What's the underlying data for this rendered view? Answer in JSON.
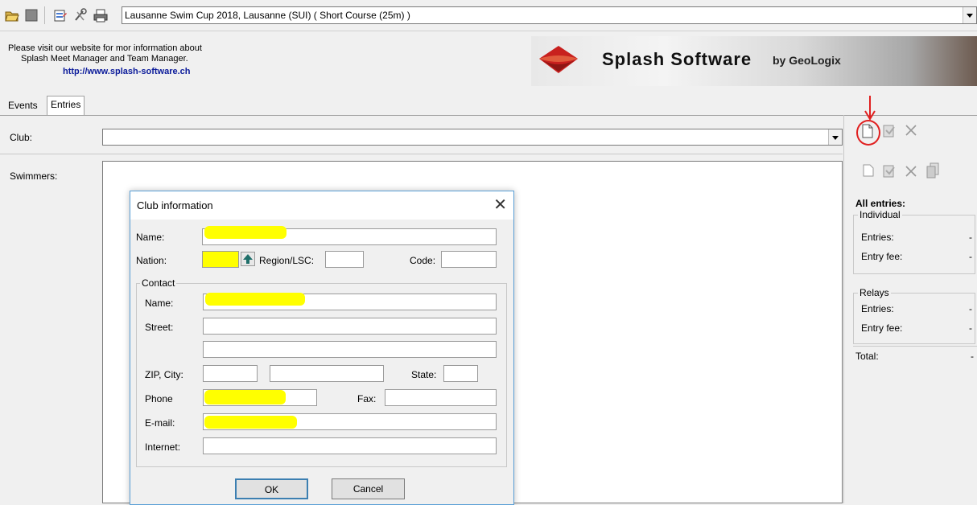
{
  "toolbar": {
    "meet_selector_value": "Lausanne Swim Cup 2018,  Lausanne  (SUI)  ( Short Course (25m) )",
    "icons": [
      "open-folder-icon",
      "stop-icon",
      "properties-icon",
      "tools-icon",
      "print-icon"
    ]
  },
  "banner": {
    "info_line1": "Please visit our website for mor information about",
    "info_line2": "Splash Meet Manager and Team Manager.",
    "url": "http://www.splash-software.ch",
    "logo_text": "Splash Software",
    "logo_by": "by GeoLogix"
  },
  "tabs": [
    {
      "label": "Events"
    },
    {
      "label": "Entries"
    }
  ],
  "main": {
    "club_label": "Club:",
    "swimmers_label": "Swimmers:",
    "club_value": ""
  },
  "right_panel": {
    "all_entries_title": "All entries:",
    "individual_group": "Individual",
    "entries_label": "Entries:",
    "entries_value": "-",
    "entry_fee_label": "Entry fee:",
    "entry_fee_value": "-",
    "relays_group": "Relays",
    "relay_entries_label": "Entries:",
    "relay_entries_value": "-",
    "relay_entry_fee_label": "Entry fee:",
    "relay_entry_fee_value": "-",
    "total_label": "Total:",
    "total_value": "-"
  },
  "dialog": {
    "title": "Club information",
    "name_label": "Name:",
    "nation_label": "Nation:",
    "region_label": "Region/LSC:",
    "code_label": "Code:",
    "contact_group": "Contact",
    "contact_name_label": "Name:",
    "street_label": "Street:",
    "zip_city_label": "ZIP, City:",
    "state_label": "State:",
    "phone_label": "Phone",
    "fax_label": "Fax:",
    "email_label": "E-mail:",
    "internet_label": "Internet:",
    "ok_label": "OK",
    "cancel_label": "Cancel",
    "highlight_color": "#ffff00"
  },
  "colors": {
    "annotation": "#e02020",
    "url": "#0a1a9a"
  }
}
